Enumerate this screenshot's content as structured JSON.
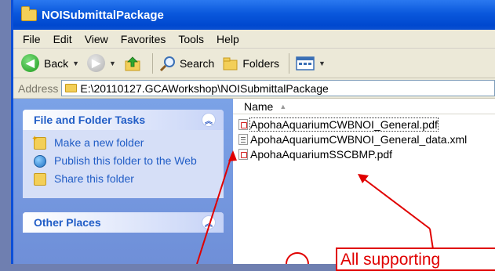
{
  "window": {
    "title": "NOISubmittalPackage"
  },
  "menu": {
    "items": [
      "File",
      "Edit",
      "View",
      "Favorites",
      "Tools",
      "Help"
    ]
  },
  "toolbar": {
    "back_label": "Back",
    "search_label": "Search",
    "folders_label": "Folders"
  },
  "address": {
    "label": "Address",
    "path": "E:\\20110127.GCAWorkshop\\NOISubmittalPackage"
  },
  "taskpane": {
    "file_tasks": {
      "title": "File and Folder Tasks",
      "items": [
        "Make a new folder",
        "Publish this folder to the Web",
        "Share this folder"
      ]
    },
    "other_places": {
      "title": "Other Places"
    }
  },
  "files": {
    "column_name": "Name",
    "items": [
      {
        "name": "ApohaAquariumCWBNOI_General.pdf",
        "type": "pdf"
      },
      {
        "name": "ApohaAquariumCWBNOI_General_data.xml",
        "type": "xml"
      },
      {
        "name": "ApohaAquariumSSCBMP.pdf",
        "type": "pdf"
      }
    ]
  },
  "annotation": {
    "text": "All supporting",
    "color": "#e00000"
  }
}
